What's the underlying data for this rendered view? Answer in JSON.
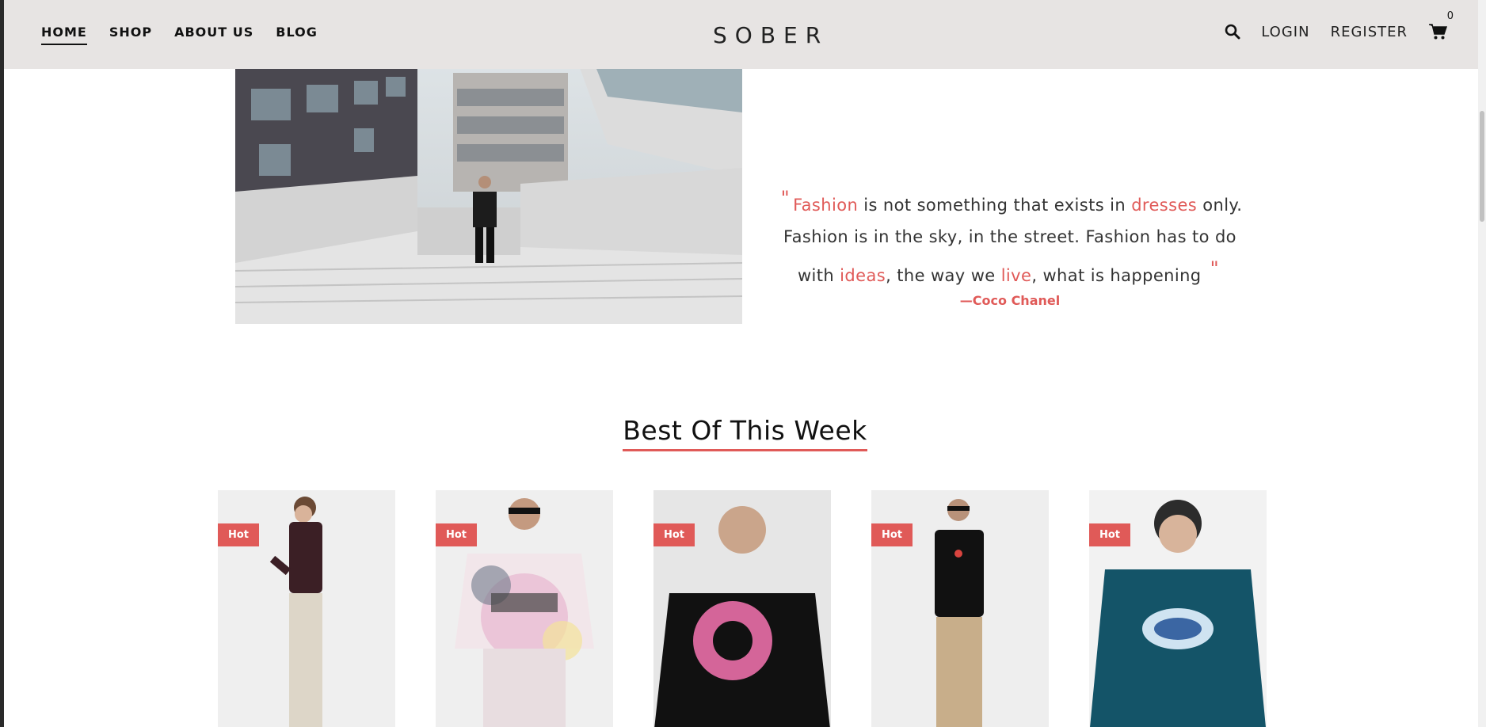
{
  "nav": {
    "left": [
      "HOME",
      "SHOP",
      "ABOUT US",
      "BLOG"
    ],
    "logo": "SOBER",
    "login": "LOGIN",
    "register": "REGISTER",
    "cart_count": "0"
  },
  "quote": {
    "open_mark": "\"",
    "w1": "Fashion",
    "t1": " is not something that exists in ",
    "w2": "dresses",
    "t2": " only. Fashion is in the sky, in the street. Fashion has to do with ",
    "w3": "ideas",
    "t3": ", the way we ",
    "w4": "live",
    "t4": ", what is happening ",
    "close_mark": "\"",
    "author": "—Coco Chanel"
  },
  "section": {
    "title": "Best Of This Week"
  },
  "products": [
    {
      "badge": "Hot"
    },
    {
      "badge": "Hot"
    },
    {
      "badge": "Hot"
    },
    {
      "badge": "Hot"
    },
    {
      "badge": "Hot"
    }
  ],
  "colors": {
    "accent": "#e05a58",
    "header_bg": "#e7e4e3"
  },
  "icons": [
    "search-icon",
    "cart-icon"
  ]
}
